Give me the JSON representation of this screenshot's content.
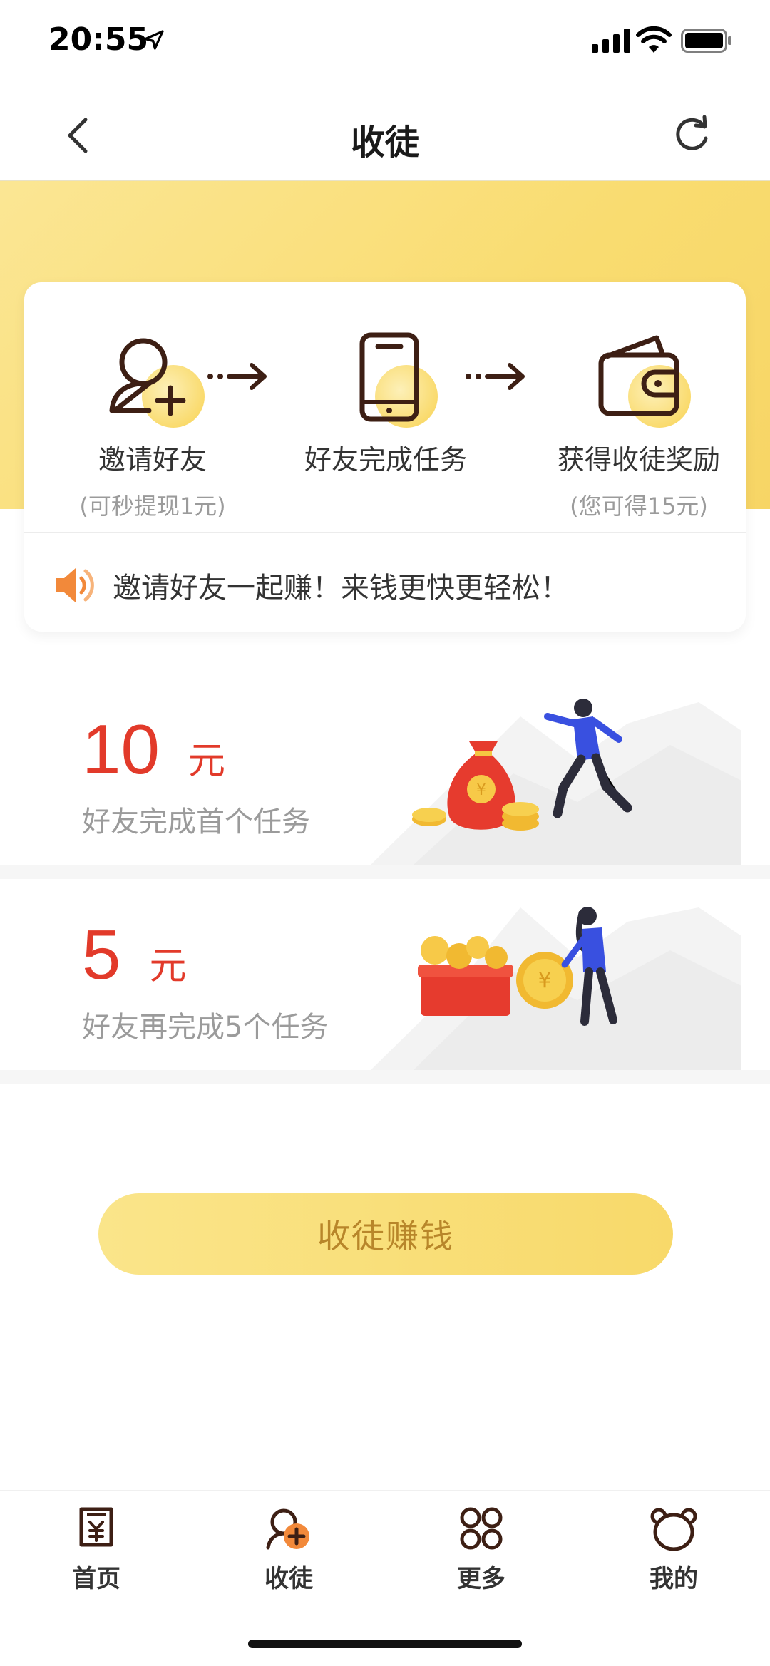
{
  "status_bar": {
    "time": "20:55",
    "icons": [
      "location-arrow-icon",
      "cellular-signal-icon",
      "wifi-icon",
      "battery-icon"
    ]
  },
  "nav": {
    "title": "收徒",
    "back_icon": "chevron-left-icon",
    "refresh_icon": "refresh-icon"
  },
  "steps": [
    {
      "icon": "add-user-icon",
      "label": "邀请好友",
      "sub": "(可秒提现1元)"
    },
    {
      "icon": "phone-icon",
      "label": "好友完成任务",
      "sub": ""
    },
    {
      "icon": "wallet-icon",
      "label": "获得收徒奖励",
      "sub": "(您可得15元)"
    }
  ],
  "notice": {
    "icon": "speaker-icon",
    "text": "邀请好友一起赚！来钱更快更轻松！"
  },
  "rewards": [
    {
      "amount": "10",
      "unit": "元",
      "desc": "好友完成首个任务"
    },
    {
      "amount": "5",
      "unit": "元",
      "desc": "好友再完成5个任务"
    }
  ],
  "cta": {
    "label": "收徒赚钱"
  },
  "tabs": [
    {
      "icon": "receipt-icon",
      "label": "首页"
    },
    {
      "icon": "recruit-icon",
      "label": "收徒"
    },
    {
      "icon": "grid-more-icon",
      "label": "更多"
    },
    {
      "icon": "bear-face-icon",
      "label": "我的"
    }
  ],
  "colors": {
    "accent_yellow": "#f8d96a",
    "reward_red": "#e23a2a",
    "cta_text": "#b8862a",
    "icon_brown": "#3d1f14"
  }
}
